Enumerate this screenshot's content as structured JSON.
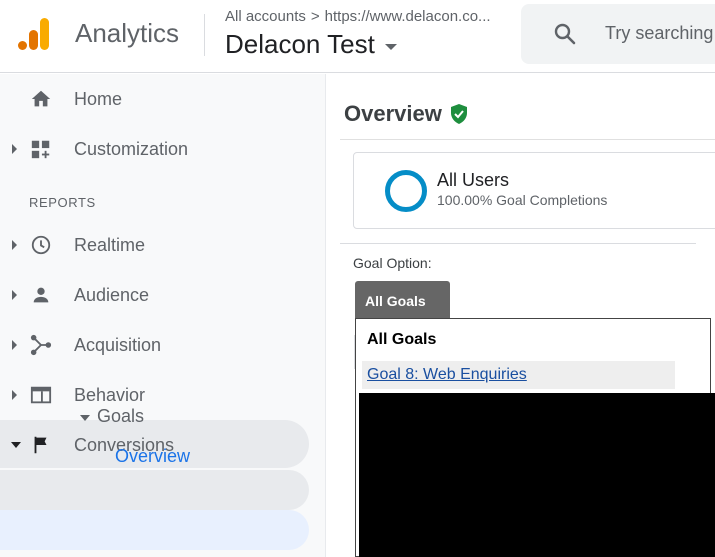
{
  "header": {
    "app_name": "Analytics",
    "breadcrumb_root": "All accounts",
    "breadcrumb_sep": ">",
    "breadcrumb_url": "https://www.delacon.co...",
    "property_name": "Delacon Test",
    "search_placeholder": "Try searching",
    "logo_colors": [
      "#f9ab00",
      "#e37400",
      "#e37400"
    ]
  },
  "sidebar": {
    "top_items": [
      {
        "label": "Home",
        "icon": "home-icon"
      },
      {
        "label": "Customization",
        "icon": "dashboard-plus-icon"
      }
    ],
    "section_label": "REPORTS",
    "report_items": [
      {
        "label": "Realtime",
        "icon": "clock-icon"
      },
      {
        "label": "Audience",
        "icon": "person-icon"
      },
      {
        "label": "Acquisition",
        "icon": "acquisition-icon"
      },
      {
        "label": "Behavior",
        "icon": "behavior-icon"
      },
      {
        "label": "Conversions",
        "icon": "flag-icon"
      }
    ],
    "sub_item": "Goals",
    "sub_sub_item": "Overview"
  },
  "main": {
    "title": "Overview",
    "segment": {
      "name": "All Users",
      "subtitle": "100.00% Goal Completions",
      "ring_color": "#058dc7"
    },
    "goal_option_label": "Goal Option:",
    "goal_tab_label": "All Goals",
    "dropdown": {
      "header": "All Goals",
      "items": [
        "Goal 8: Web Enquiries"
      ]
    }
  },
  "colors": {
    "accent": "#1a73e8",
    "verified": "#1e8e3e"
  }
}
